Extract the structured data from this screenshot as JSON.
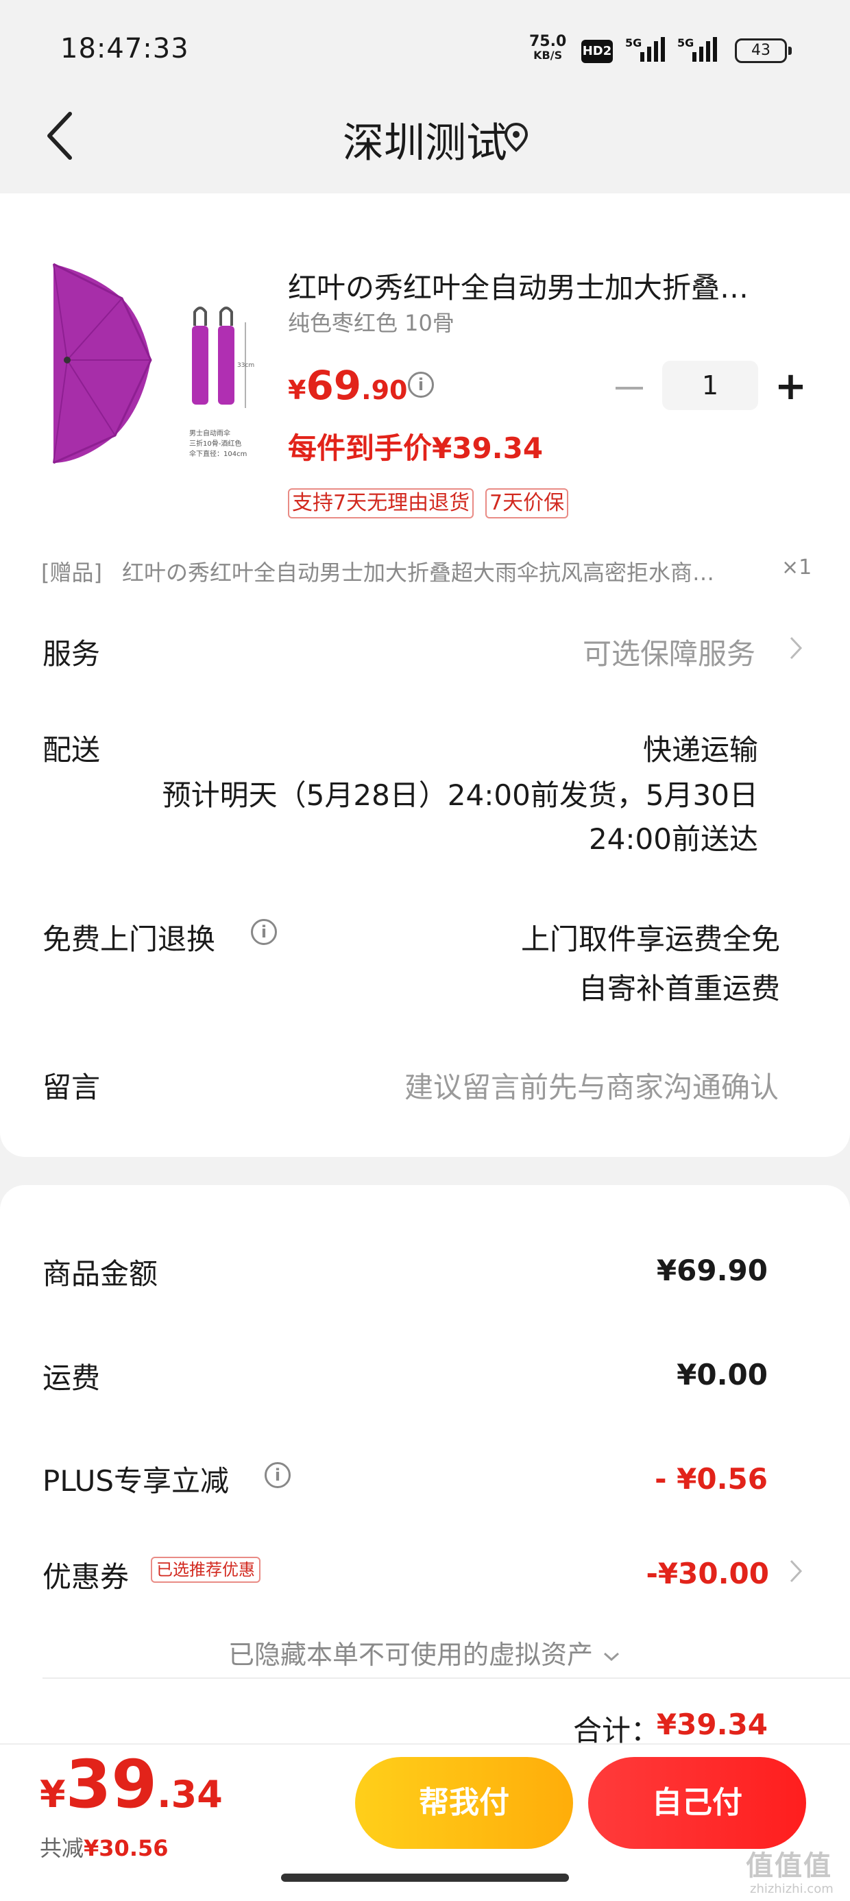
{
  "status_bar": {
    "time": "18:47:33",
    "net_speed": "75.0",
    "net_unit": "KB/S",
    "hd": "HD2",
    "sig1": "5G",
    "sig2": "5G",
    "battery": "43"
  },
  "header": {
    "title": "深圳测试",
    "back_icon": "chevron-left-icon",
    "location_icon": "location-pin-icon"
  },
  "product": {
    "name": "红叶の秀红叶全自动男士加大折叠…",
    "spec": "纯色枣红色 10骨",
    "price_currency": "¥",
    "price_int": "69",
    "price_dec": ".90",
    "info": "i",
    "qty": "1",
    "minus": "−",
    "plus": "+",
    "final_price": "每件到手价¥39.34",
    "tags": [
      "支持7天无理由退货",
      "7天价保"
    ],
    "image_caption": {
      "l1": "男士自动雨伞",
      "l2": "三折10骨-酒红色",
      "l3": "伞下直径：104cm",
      "dim": "33cm"
    }
  },
  "gift": {
    "label": "[赠品]",
    "text": "红叶の秀红叶全自动男士加大折叠超大雨伞抗风高密拒水商…",
    "count": "×1"
  },
  "service": {
    "label": "服务",
    "value": "可选保障服务"
  },
  "delivery": {
    "label": "配送",
    "method": "快递运输",
    "eta_line1": "预计明天（5月28日）24:00前发货，5月30日",
    "eta_line2": "24:00前送达"
  },
  "free_return": {
    "label": "免费上门退换",
    "line1": "上门取件享运费全免",
    "line2": "自寄补首重运费"
  },
  "message": {
    "label": "留言",
    "placeholder": "建议留言前先与商家沟通确认"
  },
  "summary": {
    "goods_label": "商品金额",
    "goods_value": "¥69.90",
    "shipping_label": "运费",
    "shipping_value": "¥0.00",
    "plus_label": "PLUS专享立减",
    "plus_value": "- ¥0.56",
    "coupon_label": "优惠券",
    "coupon_tag": "已选推荐优惠",
    "coupon_value": "-¥30.00",
    "hidden_assets": "已隐藏本单不可使用的虚拟资产",
    "total_label": "合计：",
    "total_value": "¥39.34"
  },
  "bottom": {
    "currency": "¥",
    "int": "39",
    "dec": ".34",
    "saved_label": "共减",
    "saved_value": "¥30.56",
    "help_pay": "帮我付",
    "self_pay": "自己付"
  },
  "watermark": {
    "main": "值值值",
    "sub": "zhizhizhi.com"
  },
  "colors": {
    "accent": "#e2231a",
    "help_btn": "#ffbd12",
    "self_btn": "#ff2a2a"
  }
}
